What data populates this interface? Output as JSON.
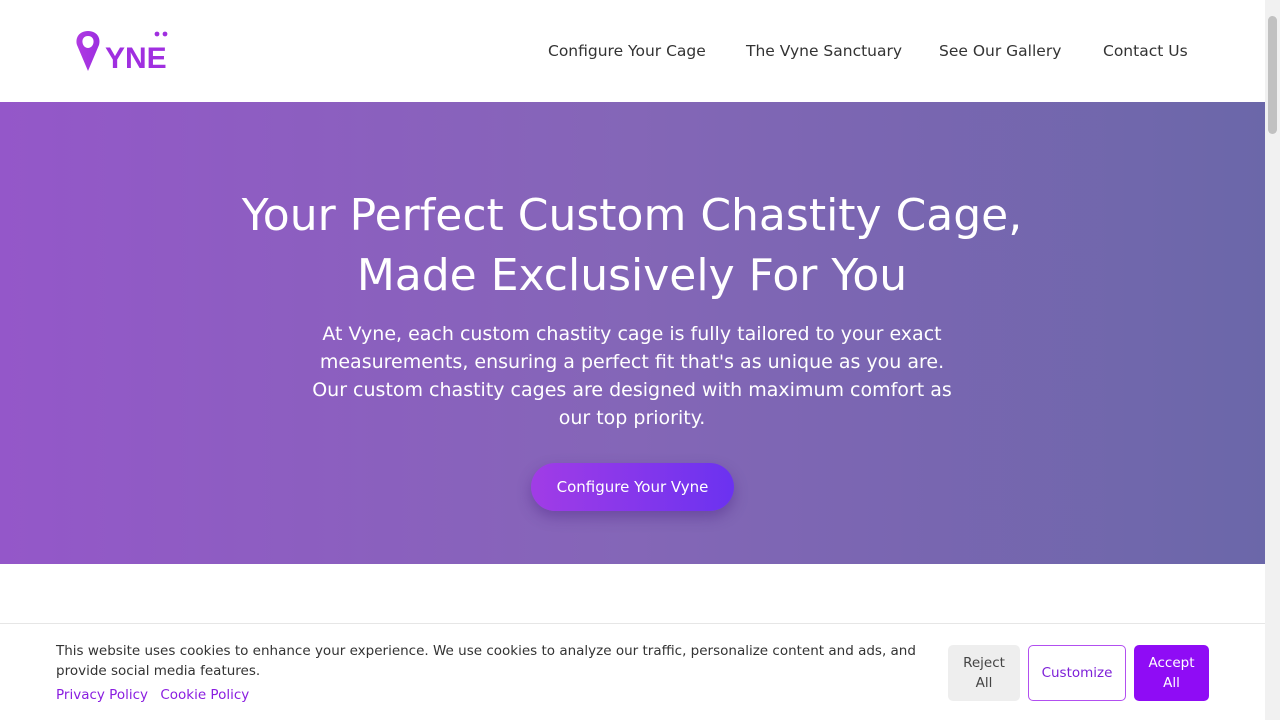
{
  "brand": {
    "logo_text": "YNE",
    "accent": "#a02fe0"
  },
  "nav": {
    "items": [
      {
        "label": "Configure Your Cage"
      },
      {
        "label": "The Vyne Sanctuary"
      },
      {
        "label": "See Our Gallery"
      },
      {
        "label": "Contact Us"
      }
    ]
  },
  "hero": {
    "title_line1": "Your Perfect Custom Chastity Cage,",
    "title_line2": "Made Exclusively For You",
    "subtitle": "At Vyne, each custom chastity cage is fully tailored to your exact measurements, ensuring a perfect fit that's as unique as you are. Our custom chastity cages are designed with maximum comfort as our top priority.",
    "cta_label": "Configure Your Vyne"
  },
  "cookie": {
    "text": "This website uses cookies to enhance your experience. We use cookies to analyze our traffic, personalize content and ads, and provide social media features.",
    "privacy_link": "Privacy Policy",
    "cookie_link": "Cookie Policy",
    "reject_line1": "Reject",
    "reject_line2": "All",
    "customize_label": "Customize",
    "accept_line1": "Accept",
    "accept_line2": "All"
  },
  "colors": {
    "hero_gradient_start": "#9457c9",
    "hero_gradient_end": "#6b67a9",
    "link": "#8a1ee0",
    "accept_bg": "#8f0cf5"
  }
}
